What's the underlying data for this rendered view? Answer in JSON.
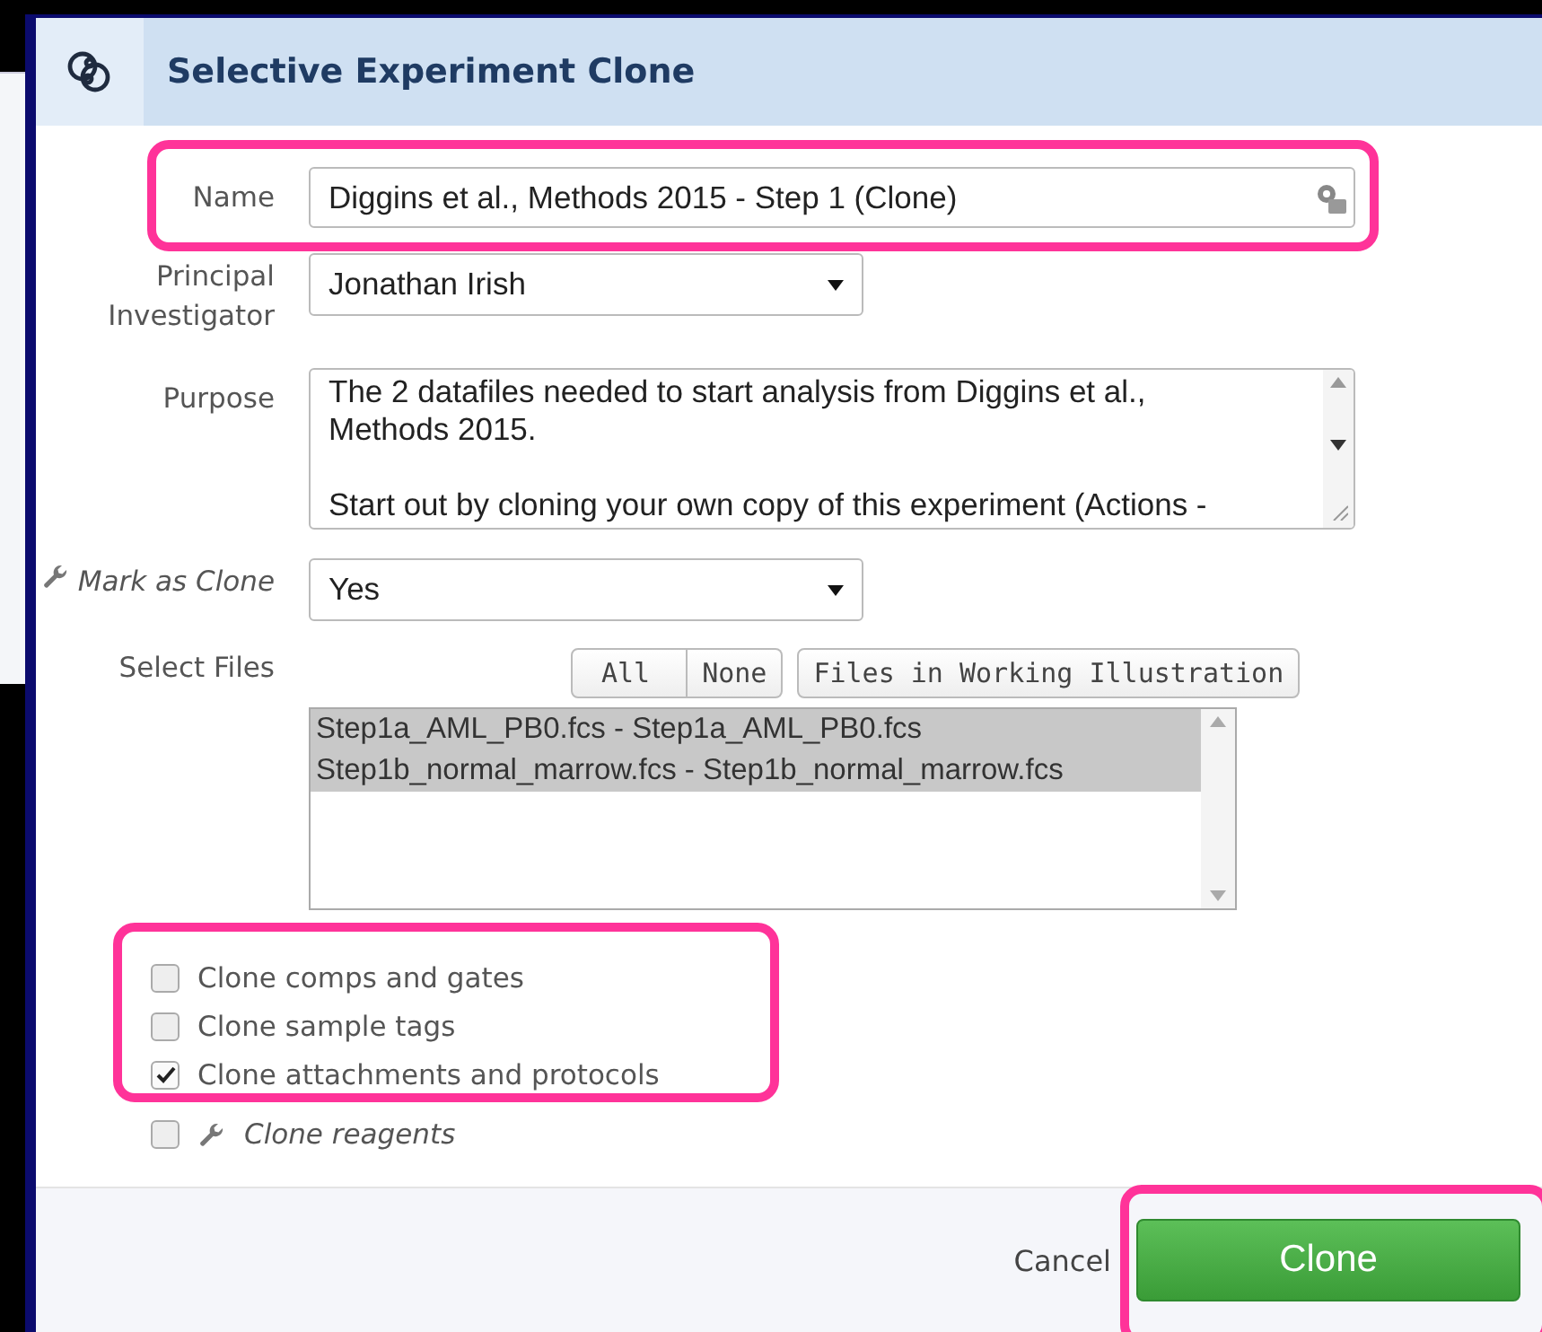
{
  "dialog": {
    "title": "Selective Experiment Clone"
  },
  "fields": [
    {
      "kind": "text",
      "label": "Name",
      "value": "Diggins et al., Methods 2015 - Step 1 (Clone)",
      "tool": false
    },
    {
      "kind": "select",
      "label": "Principal Investigator",
      "value": "Jonathan Irish",
      "tool": false
    },
    {
      "kind": "textarea",
      "label": "Purpose",
      "value": "The 2 datafiles needed to start analysis from Diggins et al., Methods 2015.\n\nStart out by cloning your own copy of this experiment (Actions -",
      "tool": false
    },
    {
      "kind": "select",
      "label": "Mark as Clone",
      "value": "Yes",
      "tool": true
    }
  ],
  "select_files": {
    "label": "Select Files",
    "buttons": [
      "All",
      "None",
      "Files in Working Illustration"
    ],
    "files": [
      {
        "label": "Step1a_AML_PB0.fcs - Step1a_AML_PB0.fcs",
        "selected": true
      },
      {
        "label": "Step1b_normal_marrow.fcs - Step1b_normal_marrow.fcs",
        "selected": true
      }
    ]
  },
  "options": [
    {
      "label": "Clone comps and gates",
      "checked": false,
      "tool": false
    },
    {
      "label": "Clone sample tags",
      "checked": false,
      "tool": false
    },
    {
      "label": "Clone attachments and protocols",
      "checked": true,
      "tool": false
    },
    {
      "label": "Clone reagents",
      "checked": false,
      "tool": true
    }
  ],
  "footer": {
    "cancel": "Cancel",
    "confirm": "Clone"
  }
}
